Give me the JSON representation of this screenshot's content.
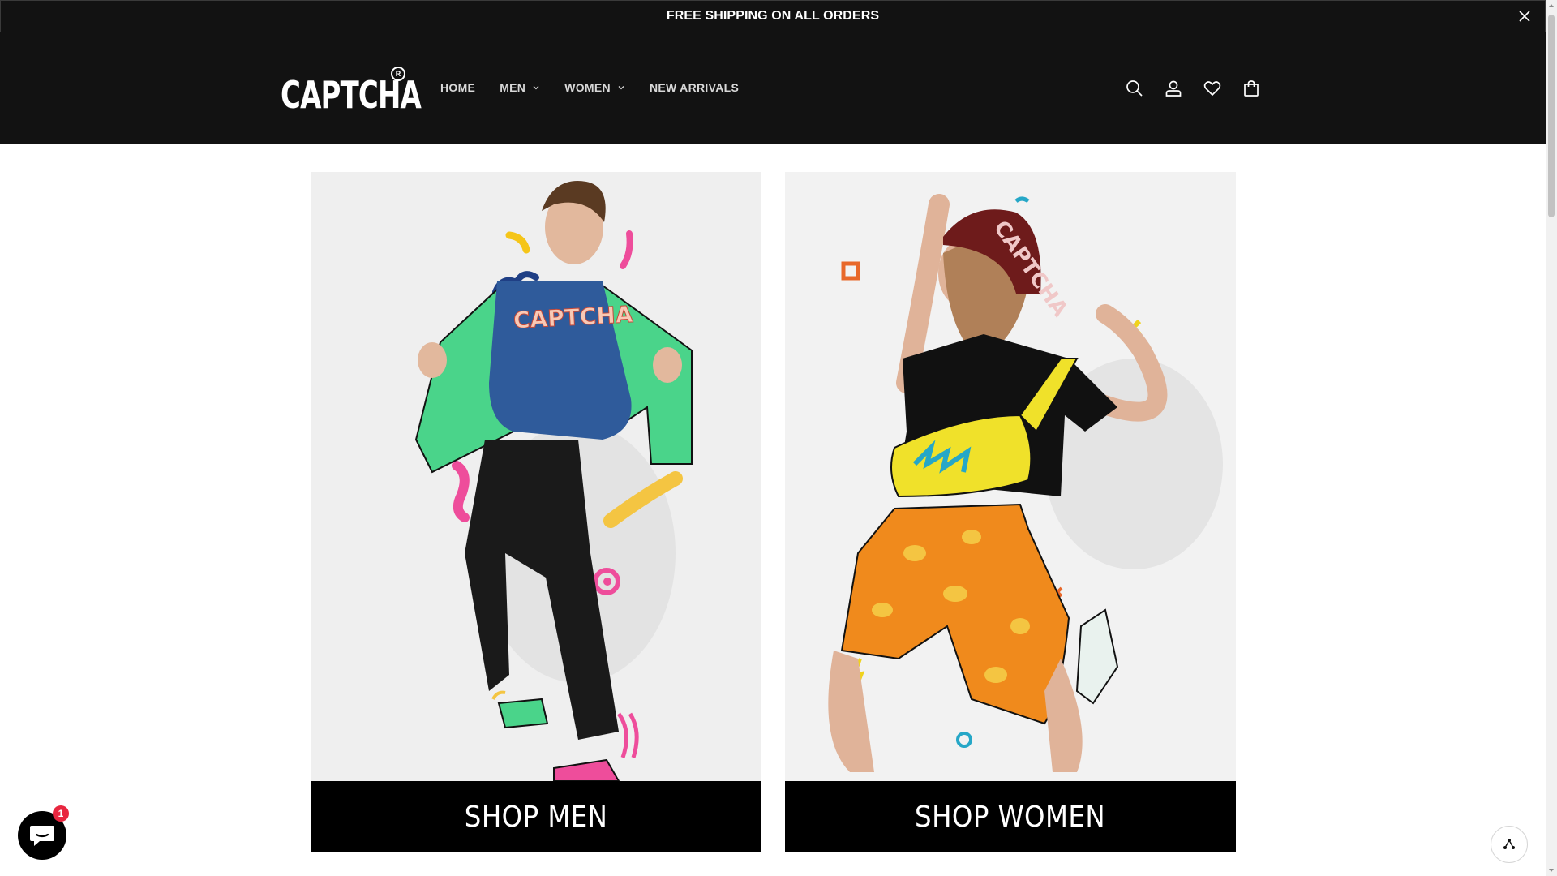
{
  "announcement": {
    "text": "FREE SHIPPING ON ALL ORDERS"
  },
  "header": {
    "logo_text": "CAPTCHA",
    "logo_reg": "R",
    "nav": [
      {
        "label": "HOME",
        "has_dropdown": false
      },
      {
        "label": "MEN",
        "has_dropdown": true
      },
      {
        "label": "WOMEN",
        "has_dropdown": true
      },
      {
        "label": "NEW ARRIVALS",
        "has_dropdown": false
      }
    ],
    "icons": [
      "search-icon",
      "account-icon",
      "wishlist-icon",
      "cart-icon"
    ]
  },
  "tiles": [
    {
      "label": "SHOP MEN",
      "image_shirt_text": "CAPTCHA"
    },
    {
      "label": "SHOP WOMEN",
      "image_hat_text": "CAPTCHA"
    }
  ],
  "chat": {
    "badge_count": "1"
  },
  "colors": {
    "header_bg": "#121212",
    "cta_bg": "#000000",
    "badge": "#e8263f",
    "nav_text": "#d8d8d8"
  }
}
